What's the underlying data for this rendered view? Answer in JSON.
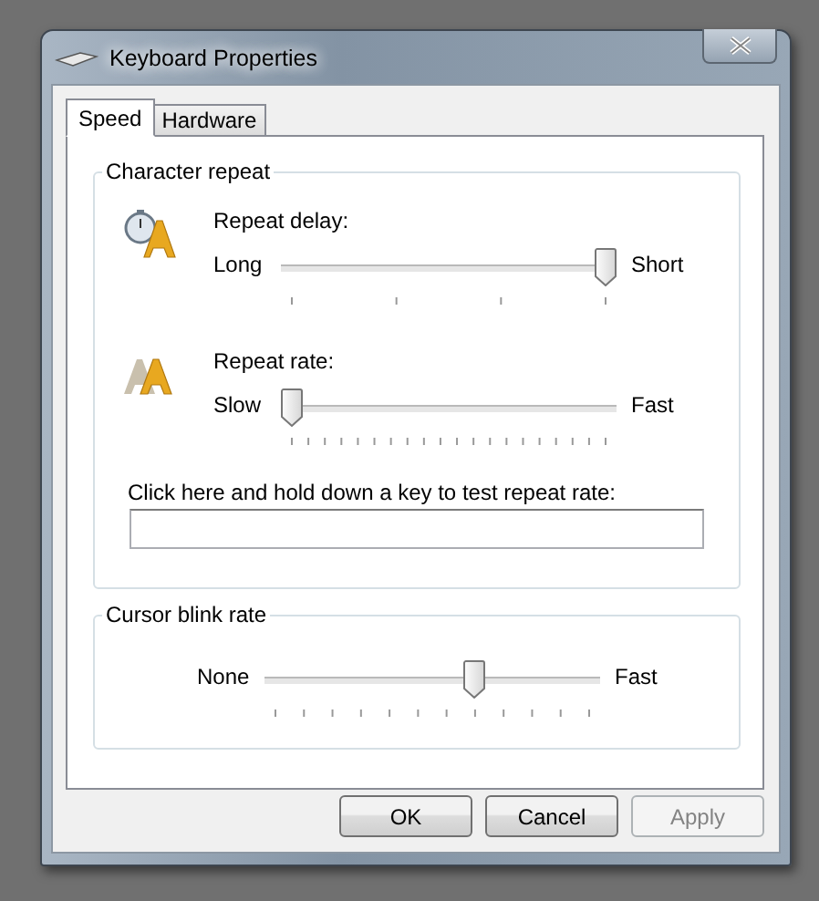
{
  "window": {
    "title": "Keyboard Properties"
  },
  "tabs": [
    {
      "label": "Speed",
      "selected": true
    },
    {
      "label": "Hardware",
      "selected": false
    }
  ],
  "character_repeat": {
    "title": "Character repeat",
    "sliders": [
      {
        "kind": "delay",
        "label": "Repeat delay:",
        "min_label": "Long",
        "max_label": "Short",
        "level": 1
      },
      {
        "kind": "rate",
        "label": "Repeat rate:",
        "min_label": "Slow",
        "max_label": "Fast",
        "level": 0
      }
    ],
    "test": {
      "label": "Click here and hold down a key to test repeat rate:"
    }
  },
  "cursor_blink": {
    "title": "Cursor blink rate",
    "slider": {
      "kind": "blink",
      "min_label": "None",
      "max_label": "Fast",
      "level": 0.636
    }
  },
  "buttons": [
    {
      "label": "OK",
      "disabled": false
    },
    {
      "label": "Cancel",
      "disabled": false
    },
    {
      "label": "Apply",
      "disabled": true
    }
  ]
}
